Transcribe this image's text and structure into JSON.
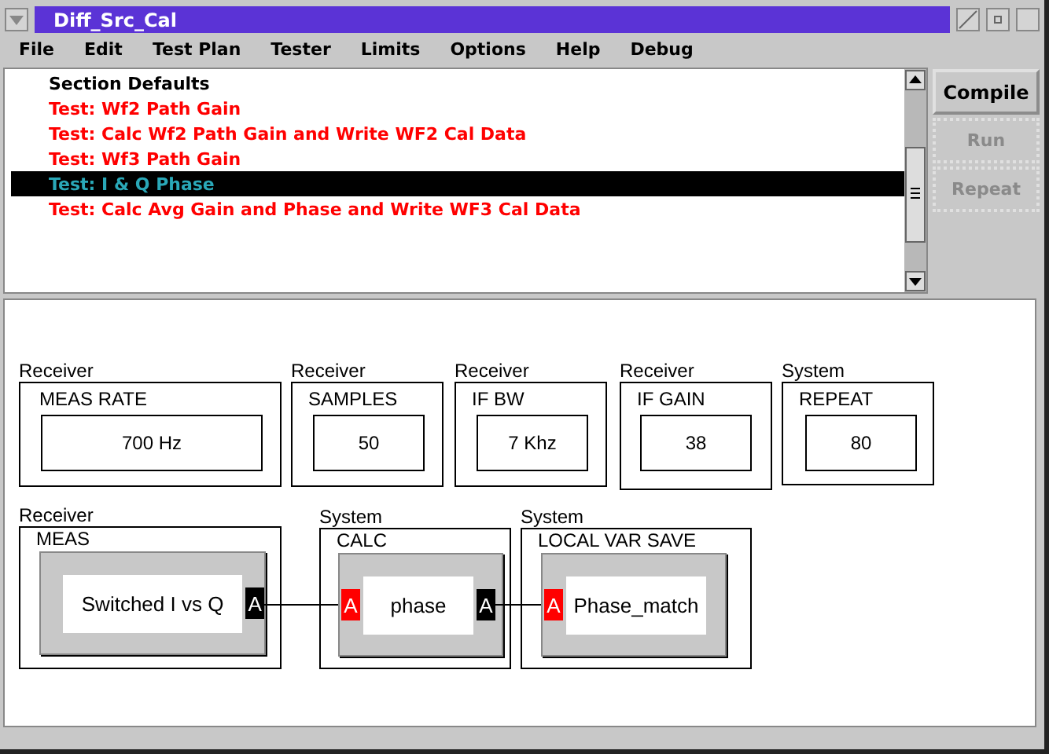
{
  "window": {
    "title": "Diff_Src_Cal"
  },
  "menu": [
    "File",
    "Edit",
    "Test Plan",
    "Tester",
    "Limits",
    "Options",
    "Help",
    "Debug"
  ],
  "test_list": [
    {
      "label": "Section Defaults",
      "kind": "section",
      "selected": false
    },
    {
      "label": "Test: Wf2 Path Gain",
      "kind": "test",
      "selected": false
    },
    {
      "label": "Test: Calc Wf2 Path Gain and Write WF2 Cal Data",
      "kind": "test",
      "selected": false
    },
    {
      "label": "Test: Wf3 Path Gain",
      "kind": "test",
      "selected": false
    },
    {
      "label": "Test: I & Q Phase",
      "kind": "test",
      "selected": true
    },
    {
      "label": "Test: Calc Avg Gain and Phase and Write WF3 Cal Data",
      "kind": "test",
      "selected": false
    }
  ],
  "buttons": [
    {
      "label": "Compile",
      "disabled": false
    },
    {
      "label": "Run",
      "disabled": true
    },
    {
      "label": "Repeat",
      "disabled": true
    }
  ],
  "parameters": [
    {
      "group": "Receiver",
      "name": "MEAS RATE",
      "value": "700  Hz"
    },
    {
      "group": "Receiver",
      "name": "SAMPLES",
      "value": "50"
    },
    {
      "group": "Receiver",
      "name": "IF BW",
      "value": "7 Khz"
    },
    {
      "group": "Receiver",
      "name": "IF GAIN",
      "value": "38"
    },
    {
      "group": "System",
      "name": "REPEAT",
      "value": "80"
    }
  ],
  "blocks": [
    {
      "group": "Receiver",
      "name": "MEAS",
      "value": "Switched I vs Q",
      "ports": [
        {
          "kind": "output",
          "label": "A",
          "color": "#000000"
        }
      ]
    },
    {
      "group": "System",
      "name": "CALC",
      "value": "phase",
      "ports": [
        {
          "kind": "input",
          "label": "A",
          "color": "#ff0000"
        },
        {
          "kind": "output",
          "label": "A",
          "color": "#000000"
        }
      ]
    },
    {
      "group": "System",
      "name": "LOCAL VAR SAVE",
      "value": "Phase_match",
      "ports": [
        {
          "kind": "input",
          "label": "A",
          "color": "#ff0000"
        }
      ]
    }
  ]
}
